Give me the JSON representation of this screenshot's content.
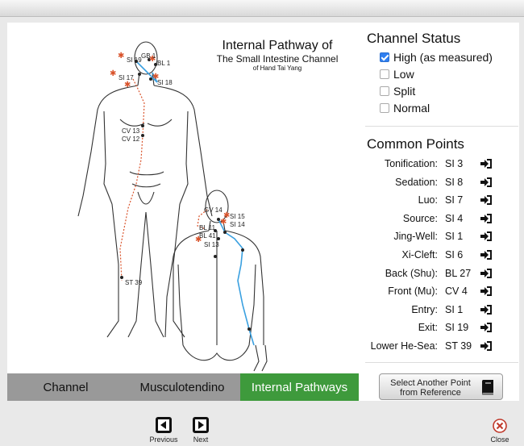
{
  "illustration": {
    "title_line1": "Internal Pathway of",
    "title_line2": "The Small Intestine Channel",
    "title_line3": "of Hand Tai Yang",
    "labels": [
      "SI 19",
      "GB 1",
      "BL 1",
      "SI 17",
      "SI 18",
      "CV 13",
      "CV 12",
      "ST 39",
      "GV 14",
      "SI 15",
      "BL 11",
      "SI 14",
      "BL 41",
      "SI 13"
    ]
  },
  "tabs": [
    {
      "label": "Channel"
    },
    {
      "label": "Musculotendino"
    },
    {
      "label": "Internal Pathways",
      "active": true
    }
  ],
  "channel_status": {
    "title": "Channel Status",
    "options": [
      {
        "label": "High (as measured)",
        "checked": true
      },
      {
        "label": "Low",
        "checked": false
      },
      {
        "label": "Split",
        "checked": false
      },
      {
        "label": "Normal",
        "checked": false
      }
    ]
  },
  "common_points": {
    "title": "Common Points",
    "rows": [
      {
        "label": "Tonification:",
        "value": "SI 3"
      },
      {
        "label": "Sedation:",
        "value": "SI 8"
      },
      {
        "label": "Luo:",
        "value": "SI 7"
      },
      {
        "label": "Source:",
        "value": "SI 4"
      },
      {
        "label": "Jing-Well:",
        "value": "SI 1"
      },
      {
        "label": "Xi-Cleft:",
        "value": "SI 6"
      },
      {
        "label": "Back (Shu):",
        "value": "BL 27"
      },
      {
        "label": "Front (Mu):",
        "value": "CV 4"
      },
      {
        "label": "Entry:",
        "value": "SI 1"
      },
      {
        "label": "Exit:",
        "value": "SI 19"
      },
      {
        "label": "Lower He-Sea:",
        "value": "ST 39"
      }
    ]
  },
  "reference_button": {
    "line1": "Select Another Point",
    "line2": "from Reference"
  },
  "nav": {
    "previous": "Previous",
    "next": "Next",
    "close": "Close"
  },
  "colors": {
    "accent_green": "#3e9a3c",
    "checkbox_blue": "#2f7ff0",
    "pathway_blue": "#3aa0e0",
    "pathway_red": "#d9532b"
  }
}
